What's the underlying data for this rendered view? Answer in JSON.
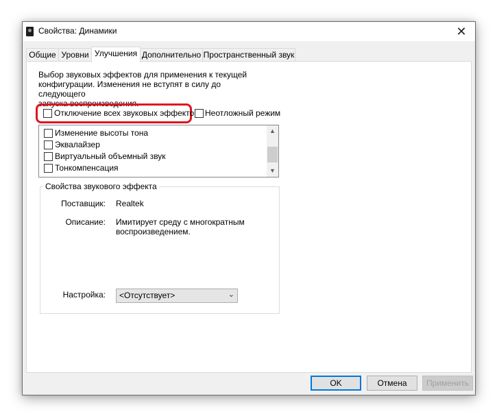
{
  "window": {
    "title": "Свойства: Динамики",
    "close_glyph": "✕"
  },
  "tabs": [
    {
      "label": "Общие"
    },
    {
      "label": "Уровни"
    },
    {
      "label": "Улучшения"
    },
    {
      "label": "Дополнительно"
    },
    {
      "label": "Пространственный звук"
    }
  ],
  "active_tab": "Улучшения",
  "enhancements": {
    "description_line1": "Выбор звуковых эффектов для применения к текущей",
    "description_line2": "конфигурации. Изменения не вступят в силу до следующего",
    "description_line3": "запуска воспроизведения.",
    "disable_all_label": "Отключение всех звуковых эффектов",
    "disable_all_checked": false,
    "immediate_mode_label": "Неотложный режим",
    "immediate_mode_checked": false,
    "effects": [
      {
        "label": "Изменение высоты тона",
        "checked": false
      },
      {
        "label": "Эквалайзер",
        "checked": false
      },
      {
        "label": "Виртуальный объемный звук",
        "checked": false
      },
      {
        "label": "Тонкомпенсация",
        "checked": false
      }
    ],
    "highlight_color": "#e0141e"
  },
  "properties": {
    "group_title": "Свойства звукового эффекта",
    "provider_label": "Поставщик:",
    "provider_value": "Realtek",
    "description_label": "Описание:",
    "description_value_line1": "Имитирует среду с многократным",
    "description_value_line2": "воспроизведением.",
    "setting_label": "Настройка:",
    "setting_value": "<Отсутствует>"
  },
  "buttons": {
    "ok": "OK",
    "cancel": "Отмена",
    "apply": "Применить"
  }
}
